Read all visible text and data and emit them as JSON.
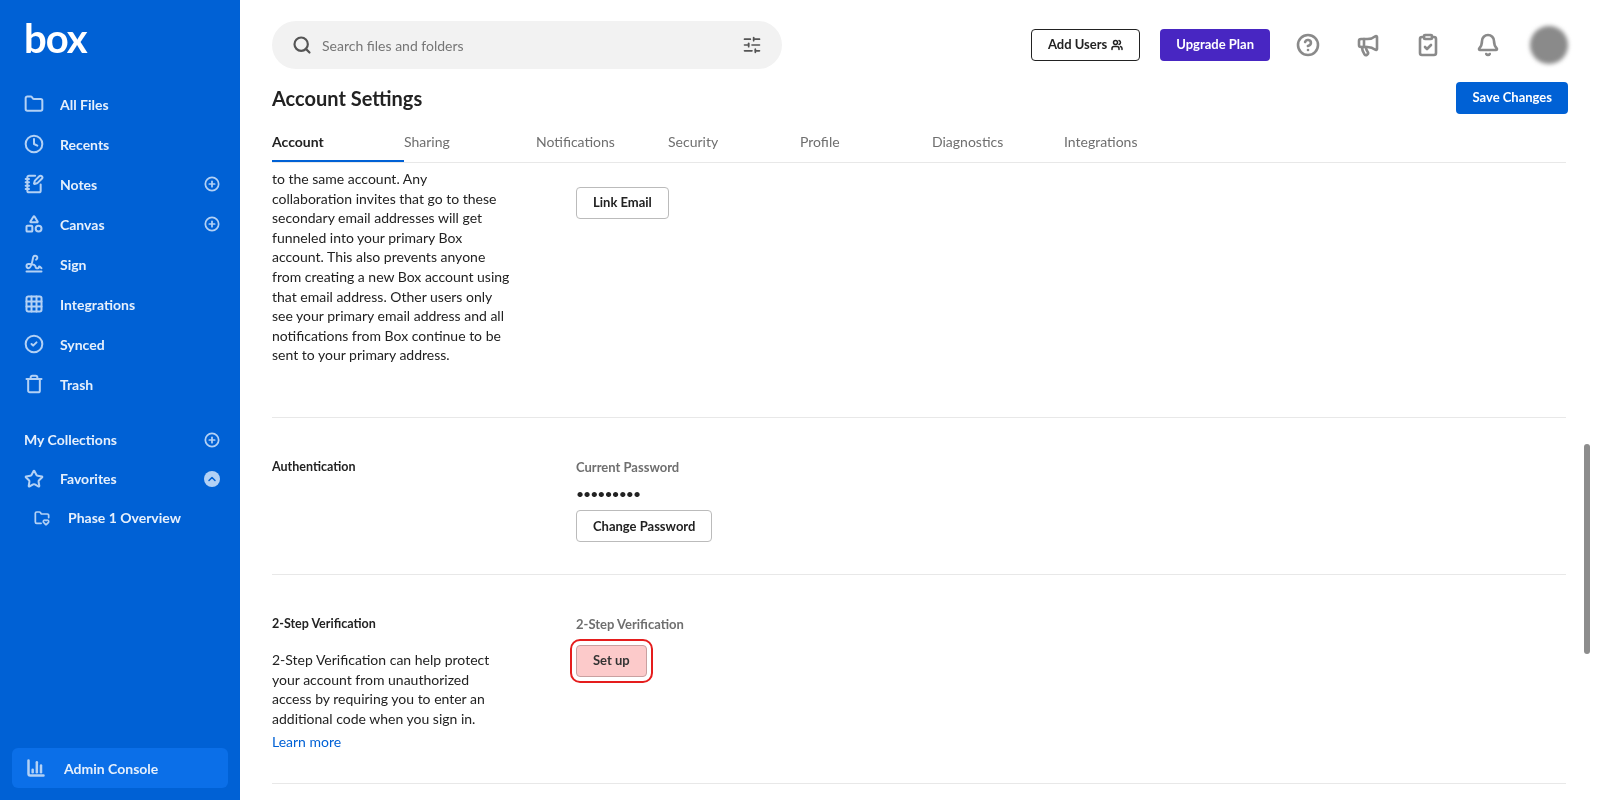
{
  "sidebar": {
    "logo": "box",
    "items": [
      {
        "label": "All Files",
        "kind": "plain"
      },
      {
        "label": "Recents",
        "kind": "plain"
      },
      {
        "label": "Notes",
        "kind": "add"
      },
      {
        "label": "Canvas",
        "kind": "add"
      },
      {
        "label": "Sign",
        "kind": "plain"
      },
      {
        "label": "Integrations",
        "kind": "plain"
      },
      {
        "label": "Synced",
        "kind": "plain"
      },
      {
        "label": "Trash",
        "kind": "plain"
      }
    ],
    "collections": {
      "label": "My Collections"
    },
    "favorites": {
      "label": "Favorites",
      "expanded": true,
      "children": [
        {
          "label": "Phase 1 Overview"
        }
      ]
    },
    "admin": {
      "label": "Admin Console"
    }
  },
  "search": {
    "placeholder": "Search files and folders"
  },
  "header": {
    "add_users": "Add Users",
    "upgrade": "Upgrade Plan"
  },
  "page": {
    "title": "Account Settings",
    "save": "Save Changes"
  },
  "tabs": [
    {
      "label": "Account",
      "selected": true
    },
    {
      "label": "Sharing",
      "selected": false
    },
    {
      "label": "Notifications",
      "selected": false
    },
    {
      "label": "Security",
      "selected": false
    },
    {
      "label": "Profile",
      "selected": false
    },
    {
      "label": "Diagnostics",
      "selected": false
    },
    {
      "label": "Integrations",
      "selected": false
    }
  ],
  "sections": [
    {
      "kind": "link_email",
      "description": "to the same account. Any collaboration invites that go to these secondary email addresses will get funneled into your primary Box account. This also prevents anyone from creating a new Box account using that email address. Other users only see your primary email address and all notifications from Box continue to be sent to your primary address.",
      "button": {
        "label": "Link Email",
        "highlighted": false
      }
    },
    {
      "kind": "password",
      "title": "Authentication",
      "field_label": "Current Password",
      "value": "•••••••••",
      "button": {
        "label": "Change Password",
        "highlighted": false
      }
    },
    {
      "kind": "two_step",
      "title": "2-Step Verification",
      "description": "2-Step Verification can help protect your account from unauthorized access by requiring you to enter an additional code when you sign in.",
      "link": "Learn more",
      "field_label": "2-Step Verification",
      "button": {
        "label": "Set up",
        "highlighted": true
      }
    }
  ]
}
